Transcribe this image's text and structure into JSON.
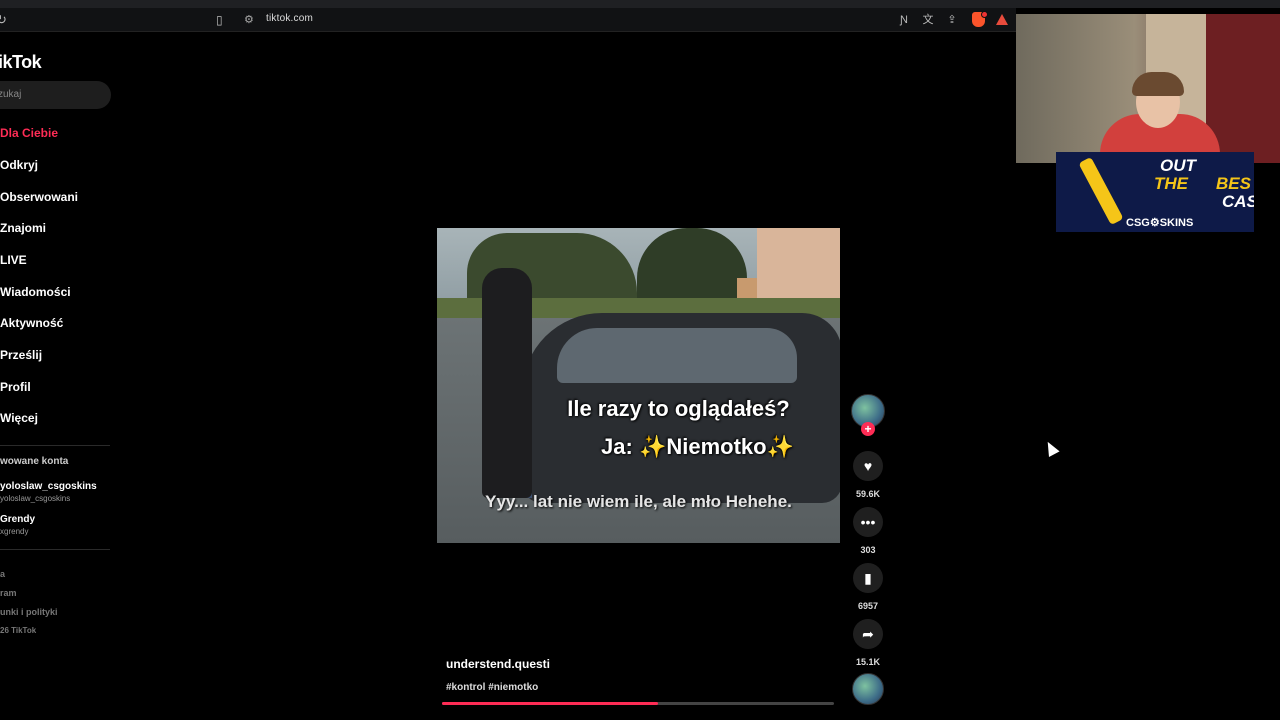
{
  "browser": {
    "url": "tiktok.com",
    "toolbar_icons": [
      "reload-icon",
      "bookmark-icon",
      "site-settings-icon",
      "reader-icon",
      "translate-icon",
      "share-icon",
      "brave-shield-icon",
      "brave-rewards-icon"
    ]
  },
  "sidebar": {
    "logo": "ikTok",
    "search_placeholder": "zukaj",
    "nav": [
      {
        "label": "Dla Ciebie",
        "active": true
      },
      {
        "label": "Odkryj"
      },
      {
        "label": "Obserwowani"
      },
      {
        "label": "Znajomi"
      },
      {
        "label": "LIVE"
      },
      {
        "label": "Wiadomości"
      },
      {
        "label": "Aktywność"
      },
      {
        "label": "Prześlij"
      },
      {
        "label": "Profil"
      },
      {
        "label": "Więcej"
      }
    ],
    "accounts_title": "wowane konta",
    "accounts": [
      {
        "name": "yoloslaw_csgoskins",
        "handle": "yoloslaw_csgoskins"
      },
      {
        "name": "Grendy",
        "handle": "xgrendy"
      }
    ],
    "footer": [
      "a",
      "ram",
      "unki i polityki",
      "26 TikTok"
    ]
  },
  "video": {
    "caption_line1": "Ile razy to oglądałeś?",
    "caption_line2": "Ja: ✨Niemotko✨",
    "subtitle": "Yyy... lat nie wiem ile, ale mło Hehehe.",
    "author": "understend.questi",
    "hashtags": "#kontrol #niemotko",
    "progress": 0.55
  },
  "actions": {
    "likes": "59.6K",
    "comments": "303",
    "saves": "6957",
    "shares": "15.1K"
  },
  "overlay_ad": {
    "line1": "OUT",
    "line2a": "THE",
    "line2b": "BES",
    "line3": "CASE",
    "brand": "CSG⚙SKINS"
  },
  "colors": {
    "accent": "#fe2c55",
    "background": "#000000",
    "ad_yellow": "#f5c518"
  }
}
